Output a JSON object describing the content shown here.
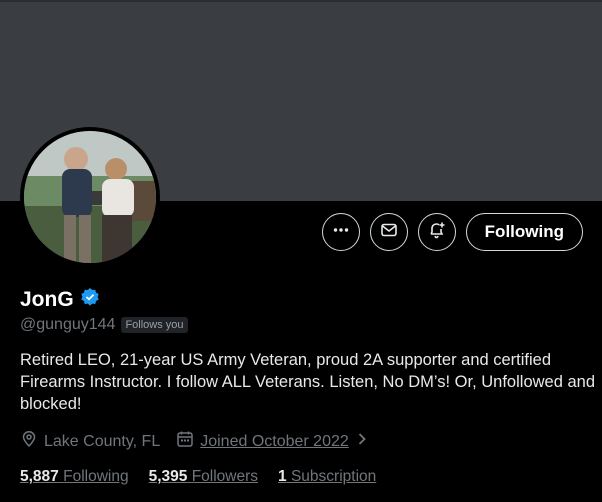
{
  "profile": {
    "name": "JonG",
    "handle": "@gunguy144",
    "follows_you": "Follows you",
    "bio": "Retired LEO, 21-year US Army Veteran, proud 2A supporter and certified Firearms Instructor. I follow ALL Veterans. Listen, No DM’s! Or, Unfollowed and blocked!",
    "location": "Lake County, FL",
    "joined": "Joined October 2022"
  },
  "actions": {
    "more_icon": "more-horizontal-icon",
    "message_icon": "envelope-icon",
    "notify_icon": "bell-plus-icon",
    "follow_label": "Following"
  },
  "stats": {
    "following_count": "5,887",
    "following_label": "Following",
    "followers_count": "5,395",
    "followers_label": "Followers",
    "subscription_count": "1",
    "subscription_label": "Subscription"
  },
  "colors": {
    "background": "#000000",
    "banner": "#3a3d41",
    "verified": "#1d9bf0",
    "muted_text": "#71767b"
  }
}
